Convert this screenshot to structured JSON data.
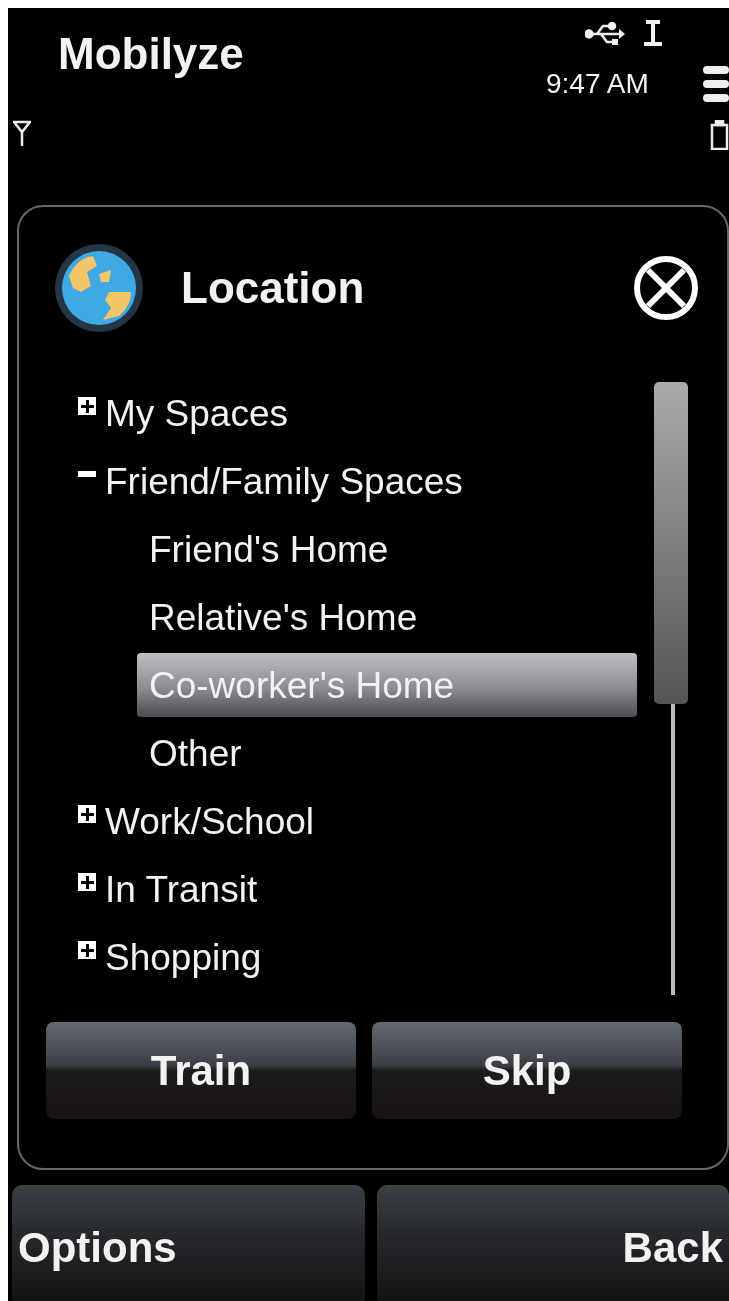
{
  "app_title": "Mobilyze",
  "status_bar": {
    "time": "9:47 AM"
  },
  "dialog": {
    "title": "Location",
    "tree": [
      {
        "label": "My Spaces",
        "expanded": false
      },
      {
        "label": "Friend/Family Spaces",
        "expanded": true,
        "children": [
          {
            "label": "Friend's Home",
            "selected": false
          },
          {
            "label": "Relative's Home",
            "selected": false
          },
          {
            "label": "Co-worker's Home",
            "selected": true
          },
          {
            "label": "Other",
            "selected": false
          }
        ]
      },
      {
        "label": "Work/School",
        "expanded": false
      },
      {
        "label": "In Transit",
        "expanded": false
      },
      {
        "label": "Shopping",
        "expanded": false
      }
    ],
    "buttons": [
      "Train",
      "Skip"
    ]
  },
  "softkeys": {
    "left": "Options",
    "right": "Back"
  }
}
